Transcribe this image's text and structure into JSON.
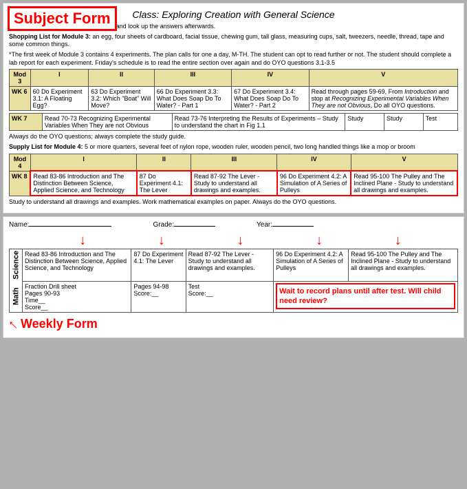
{
  "subjectForm": {
    "title": "Subject Form",
    "classTitle": "Class: Exploring Creation with General Science",
    "instructions1": "Always do the On Your Own questions and look up the answers afterwards.",
    "shoppingList3": "Shopping List for Module 3: an egg, four sheets of cardboard, facial tissue, chewing gum, tall glass, measuring cups, salt, tweezers, needle, thread, tape and some common things.",
    "note1": "*The first week of Module 3 contains 4 experiments. The plan calls for one a day, M-TH. The student can opt to read further or not. The student should complete a lab report for each experiment. Friday's schedule is to read the entire section over again and do OYO questions 3.1-3.5",
    "mod3": {
      "header": [
        "Mod 3",
        "I",
        "II",
        "III",
        "IV",
        "V"
      ],
      "wk6": [
        "WK 6",
        "60 Do Experiment 3.1: A Floating Egg?",
        "63 Do Experiment 3.2: Which \"Boat\" Will Move?",
        "66 Do Experiment 3.3: What Does Soap Do To Water? - Part 1",
        "67 Do Experiment 3.4: What Does Soap Do To Water? - Part 2",
        "Read through pages 59-69, From Introduction and stop at Recognizing Experimental Variables When They are not Obvious, Do all OYO questions."
      ]
    },
    "wk7row": {
      "wk": "WK 7",
      "col1": "Read 70-73 Recognizing Experimental Variables When They are not Obvious",
      "col2": "Read 73-76 Interpreting the Results of Experiments – Study to understand the chart in Fig 1.1",
      "study1": "Study",
      "study2": "Study",
      "test": "Test"
    },
    "instructions2": "Always do the OYO questions; always complete the study guide.",
    "shoppingList4": "Supply List for Module 4: 5 or more quarters, several feet of nylon rope, wooden ruler, wooden pencil, two long handled things like a mop or broom",
    "mod4": {
      "header": [
        "Mod 4",
        "I",
        "II",
        "III",
        "IV",
        "V"
      ],
      "wk8": [
        "WK 8",
        "Read 83-86 Introduction and The Distinction Between Science, Applied Science, and Technology",
        "87 Do Experiment 4.1: The Lever",
        "Read 87-92 The Lever - Study to understand all drawings and examples.",
        "96 Do Experiment 4.2: A Simulation of A Series of Pulleys",
        "Read 95-100 The Pulley and The Inclined Plane - Study to understand all drawings and examples."
      ]
    },
    "instructions3": "Study to understand all drawings and examples. Work mathematical examples on paper. Always do the OYO questions."
  },
  "weeklyForm": {
    "nameLabel": "Name:",
    "gradeLabel": "Grade:",
    "yearLabel": "Year:",
    "scienceLabel": "Science",
    "mathLabel": "Math",
    "scienceRow": [
      "Read 83-86 Introduction and The Distinction Between Science, Applied Science, and Technology",
      "87 Do Experiment 4.1: The Lever",
      "Read 87-92 The Lever - Study to understand all drawings and examples.",
      "96 Do Experiment 4.2: A Simulation of A Series of Pulleys",
      "Read 95-100 The Pulley and The Inclined Plane - Study to understand all drawings and examples."
    ],
    "mathRow": [
      "Fraction Drill sheet\nPages 90-93\nTime__\nScore__",
      "Pages 94-98\nScore:__",
      "Test\nScore:__",
      "Wait to record plans until after test. Will child need review?"
    ],
    "weeklyFormTitle": "Weekly Form"
  },
  "arrows": {
    "color": "red"
  }
}
